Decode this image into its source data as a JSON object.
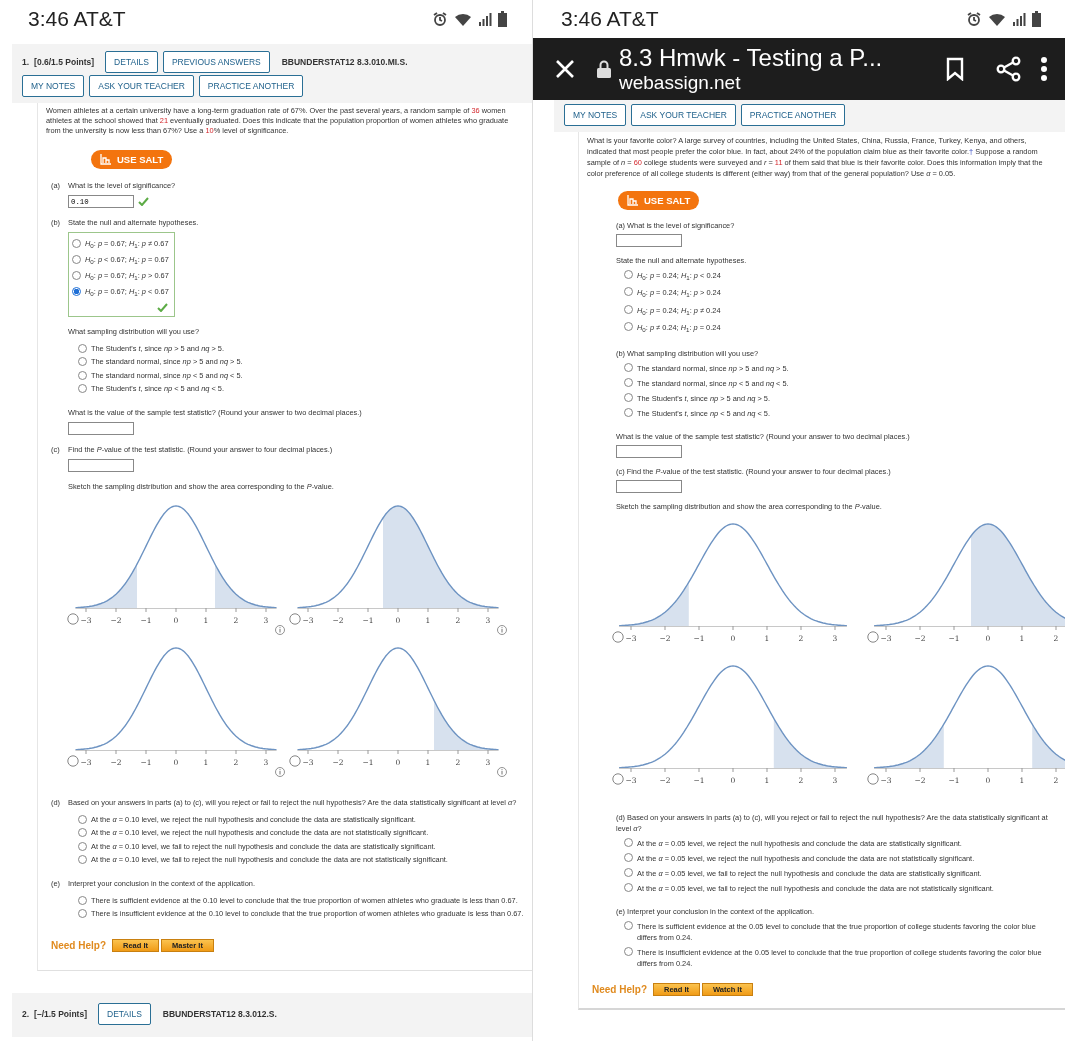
{
  "screens": [
    {
      "status_bar": {
        "time": "3:46 AT&T"
      },
      "question": {
        "header": {
          "number": "1.",
          "points": "[0.6/1.5 Points]",
          "buttons": [
            "DETAILS",
            "PREVIOUS ANSWERS"
          ],
          "code": "BBUNDERSTAT12 8.3.010.MI.S."
        },
        "tools": [
          "MY NOTES",
          "ASK YOUR TEACHER",
          "PRACTICE ANOTHER"
        ],
        "prompt": [
          {
            "kind": "text",
            "text": "Women athletes at a certain university have a long-term graduation rate of 67%. Over the past several years, a random sample of "
          },
          {
            "kind": "value",
            "text": "36"
          },
          {
            "kind": "text",
            "text": " women athletes at the school showed that "
          },
          {
            "kind": "value",
            "text": "21"
          },
          {
            "kind": "text",
            "text": " eventually graduated. Does this indicate that the population proportion of women athletes who graduate from the university is now less than 67%? Use a "
          },
          {
            "kind": "value",
            "text": "10"
          },
          {
            "kind": "text",
            "text": "% level of significance."
          }
        ],
        "salt_button": "USE SALT",
        "parts": [
          {
            "kind": "prompt",
            "letter": "(a)",
            "text": "What is the level of significance?"
          },
          {
            "kind": "answer",
            "value": "0.10",
            "correct": true
          },
          {
            "kind": "prompt",
            "letter": "(b)",
            "text": "State the null and alternate hypotheses."
          },
          {
            "kind": "choices",
            "boxed": true,
            "correct": true,
            "options": [
              {
                "text": "*H*$_{0}$: *p* = 0.67; *H*$_{1}$: *p* ≠ 0.67",
                "selected": false
              },
              {
                "text": "*H*$_{0}$: *p* < 0.67; *H*$_{1}$: *p* = 0.67",
                "selected": false
              },
              {
                "text": "*H*$_{0}$: *p* = 0.67; *H*$_{1}$: *p* > 0.67",
                "selected": false
              },
              {
                "text": "*H*$_{0}$: *p* = 0.67; *H*$_{1}$: *p* < 0.67",
                "selected": true
              }
            ]
          },
          {
            "kind": "prompt",
            "text": "What sampling distribution will you use?"
          },
          {
            "kind": "choices",
            "options": [
              {
                "text": "The Student's *t*, since *np* > 5 and *nq* > 5.",
                "selected": false
              },
              {
                "text": "The standard normal, since *np* > 5 and *nq* > 5.",
                "selected": false
              },
              {
                "text": "The standard normal, since *np* < 5 and *nq* < 5.",
                "selected": false
              },
              {
                "text": "The Student's *t*, since *np* < 5 and *nq* < 5.",
                "selected": false
              }
            ]
          },
          {
            "kind": "prompt",
            "text": "What is the value of the sample test statistic? (Round your answer to two decimal places.)"
          },
          {
            "kind": "answer"
          },
          {
            "kind": "prompt",
            "letter": "(c)",
            "text": "Find the *P*-value of the test statistic. (Round your answer to four decimal places.)"
          },
          {
            "kind": "answer"
          },
          {
            "kind": "prompt",
            "text": "Sketch the sampling distribution and show the area corresponding to the *P*-value."
          },
          {
            "kind": "graphs",
            "graphs": [
              {
                "kind": "two_tails",
                "selected": false,
                "info_icon": true,
                "ticks": [
                  "−3",
                  "−2",
                  "−1",
                  "0",
                  "1",
                  "2",
                  "3"
                ]
              },
              {
                "kind": "upper_region",
                "selected": false,
                "info_icon": true,
                "ticks": [
                  "−3",
                  "−2",
                  "−1",
                  "0",
                  "1",
                  "2",
                  "3"
                ]
              },
              {
                "kind": "none",
                "selected": false,
                "info_icon": true,
                "ticks": [
                  "−3",
                  "−2",
                  "−1",
                  "0",
                  "1",
                  "2",
                  "3"
                ]
              },
              {
                "kind": "right_tail",
                "selected": false,
                "info_icon": true,
                "ticks": [
                  "−3",
                  "−2",
                  "−1",
                  "0",
                  "1",
                  "2",
                  "3"
                ]
              }
            ]
          },
          {
            "kind": "prompt",
            "letter": "(d)",
            "text": "Based on your answers in parts (a) to (c), will you reject or fail to reject the null hypothesis? Are the data statistically significant at level *α*?"
          },
          {
            "kind": "choices",
            "options": [
              {
                "text": "At the *α* = 0.10 level, we reject the null hypothesis and conclude the data are statistically significant.",
                "selected": false
              },
              {
                "text": "At the *α* = 0.10 level, we reject the null hypothesis and conclude the data are not statistically significant.",
                "selected": false
              },
              {
                "text": "At the *α* = 0.10 level, we fail to reject the null hypothesis and conclude the data are statistically significant.",
                "selected": false
              },
              {
                "text": "At the *α* = 0.10 level, we fail to reject the null hypothesis and conclude the data are not statistically significant.",
                "selected": false
              }
            ]
          },
          {
            "kind": "prompt",
            "letter": "(e)",
            "text": "Interpret your conclusion in the context of the application."
          },
          {
            "kind": "choices",
            "options": [
              {
                "text": "There is sufficient evidence at the 0.10 level to conclude that the true proportion of women athletes who graduate is less than 0.67.",
                "selected": false
              },
              {
                "text": "There is insufficient evidence at the 0.10 level to conclude that the true proportion of women athletes who graduate is less than 0.67.",
                "selected": false
              }
            ]
          }
        ],
        "help": {
          "label": "Need Help?",
          "buttons": [
            "Read It",
            "Master It"
          ]
        }
      },
      "next_question": {
        "number": "2.",
        "points": "[–/1.5 Points]",
        "buttons": [
          "DETAILS"
        ],
        "code": "BBUNDERSTAT12 8.3.012.S."
      }
    },
    {
      "status_bar": {
        "time": "3:46 AT&T"
      },
      "browser_bar": {
        "title": "8.3 Hmwk - Testing a P...",
        "url": "webassign.net"
      },
      "question": {
        "tools": [
          "MY NOTES",
          "ASK YOUR TEACHER",
          "PRACTICE ANOTHER"
        ],
        "prompt": [
          {
            "kind": "text",
            "text": "What is your favorite color? A large survey of countries, including the United States, China, Russia, France, Turkey, Kenya, and others, indicated that most people prefer the color blue. In fact, about 24% of the population claim blue as their favorite color."
          },
          {
            "kind": "link",
            "text": "†"
          },
          {
            "kind": "text",
            "text": " Suppose a random sample of *n* = "
          },
          {
            "kind": "value",
            "text": "60"
          },
          {
            "kind": "text",
            "text": " college students were surveyed and *r* = "
          },
          {
            "kind": "value",
            "text": "11"
          },
          {
            "kind": "text",
            "text": " of them said that blue is their favorite color. Does this information imply that the color preference of all college students is different (either way) from that of the general population? Use *α* = 0.05."
          }
        ],
        "salt_button": "USE SALT",
        "parts": [
          {
            "kind": "prompt",
            "text": "(a) What is the level of significance?"
          },
          {
            "kind": "answer"
          },
          {
            "kind": "prompt",
            "text": "State the null and alternate hypotheses."
          },
          {
            "kind": "choices",
            "options": [
              {
                "text": "*H*$_{0}$: *p* = 0.24; *H*$_{1}$: *p* < 0.24",
                "selected": false
              },
              {
                "text": "*H*$_{0}$: *p* = 0.24; *H*$_{1}$: *p* > 0.24",
                "selected": false
              },
              {
                "text": "*H*$_{0}$: *p* = 0.24; *H*$_{1}$: *p* ≠ 0.24",
                "selected": false
              },
              {
                "text": "*H*$_{0}$: *p* ≠ 0.24; *H*$_{1}$: *p* = 0.24",
                "selected": false
              }
            ]
          },
          {
            "kind": "prompt",
            "text": "(b) What sampling distribution will you use?"
          },
          {
            "kind": "choices",
            "options": [
              {
                "text": "The standard normal, since *np* > 5 and *nq* > 5.",
                "selected": false
              },
              {
                "text": "The standard normal, since *np* < 5 and *nq* < 5.",
                "selected": false
              },
              {
                "text": "The Student's *t*, since *np* > 5 and *nq* > 5.",
                "selected": false
              },
              {
                "text": "The Student's *t*, since *np* < 5 and *nq* < 5.",
                "selected": false
              }
            ]
          },
          {
            "kind": "prompt",
            "text": "What is the value of the sample test statistic? (Round your answer to two decimal places.)"
          },
          {
            "kind": "answer"
          },
          {
            "kind": "prompt",
            "text": "(c) Find the *P*-value of the test statistic. (Round your answer to four decimal places.)"
          },
          {
            "kind": "answer"
          },
          {
            "kind": "prompt",
            "text": "Sketch the sampling distribution and show the area corresponding to the *P*-value."
          },
          {
            "kind": "graphs",
            "graphs": [
              {
                "kind": "left_tail",
                "selected": false,
                "ticks": [
                  "−3",
                  "−2",
                  "−1",
                  "0",
                  "1",
                  "2",
                  "3"
                ]
              },
              {
                "kind": "upper_region",
                "selected": false,
                "ticks": [
                  "−3",
                  "−2",
                  "−1",
                  "0",
                  "1",
                  "2"
                ]
              },
              {
                "kind": "right_tail",
                "selected": false,
                "ticks": [
                  "−3",
                  "−2",
                  "−1",
                  "0",
                  "1",
                  "2",
                  "3"
                ]
              },
              {
                "kind": "two_tails",
                "selected": false,
                "ticks": [
                  "−3",
                  "−2",
                  "−1",
                  "0",
                  "1",
                  "2"
                ]
              }
            ]
          },
          {
            "kind": "prompt",
            "text": "(d) Based on your answers in parts (a) to (c), will you reject or fail to reject the null hypothesis? Are the data statistically significant at level *α*?"
          },
          {
            "kind": "choices",
            "options": [
              {
                "text": "At the *α* = 0.05 level, we reject the null hypothesis and conclude the data are statistically significant.",
                "selected": false
              },
              {
                "text": "At the *α* = 0.05 level, we reject the null hypothesis and conclude the data are not statistically significant.",
                "selected": false
              },
              {
                "text": "At the *α* = 0.05 level, we fail to reject the null hypothesis and conclude the data are statistically significant.",
                "selected": false
              },
              {
                "text": "At the *α* = 0.05 level, we fail to reject the null hypothesis and conclude the data are not statistically significant.",
                "selected": false
              }
            ]
          },
          {
            "kind": "prompt",
            "text": "(e) Interpret your conclusion in the context of the application."
          },
          {
            "kind": "choices",
            "options": [
              {
                "text": "There is sufficient evidence at the 0.05 level to conclude that the true proportion of college students favoring the color blue differs from 0.24.",
                "selected": false
              },
              {
                "text": "There is insufficient evidence at the 0.05 level to conclude that the true proportion of college students favoring the color blue differs from 0.24.",
                "selected": false
              }
            ]
          }
        ],
        "help": {
          "label": "Need Help?",
          "buttons": [
            "Read It",
            "Watch It"
          ]
        }
      }
    }
  ]
}
